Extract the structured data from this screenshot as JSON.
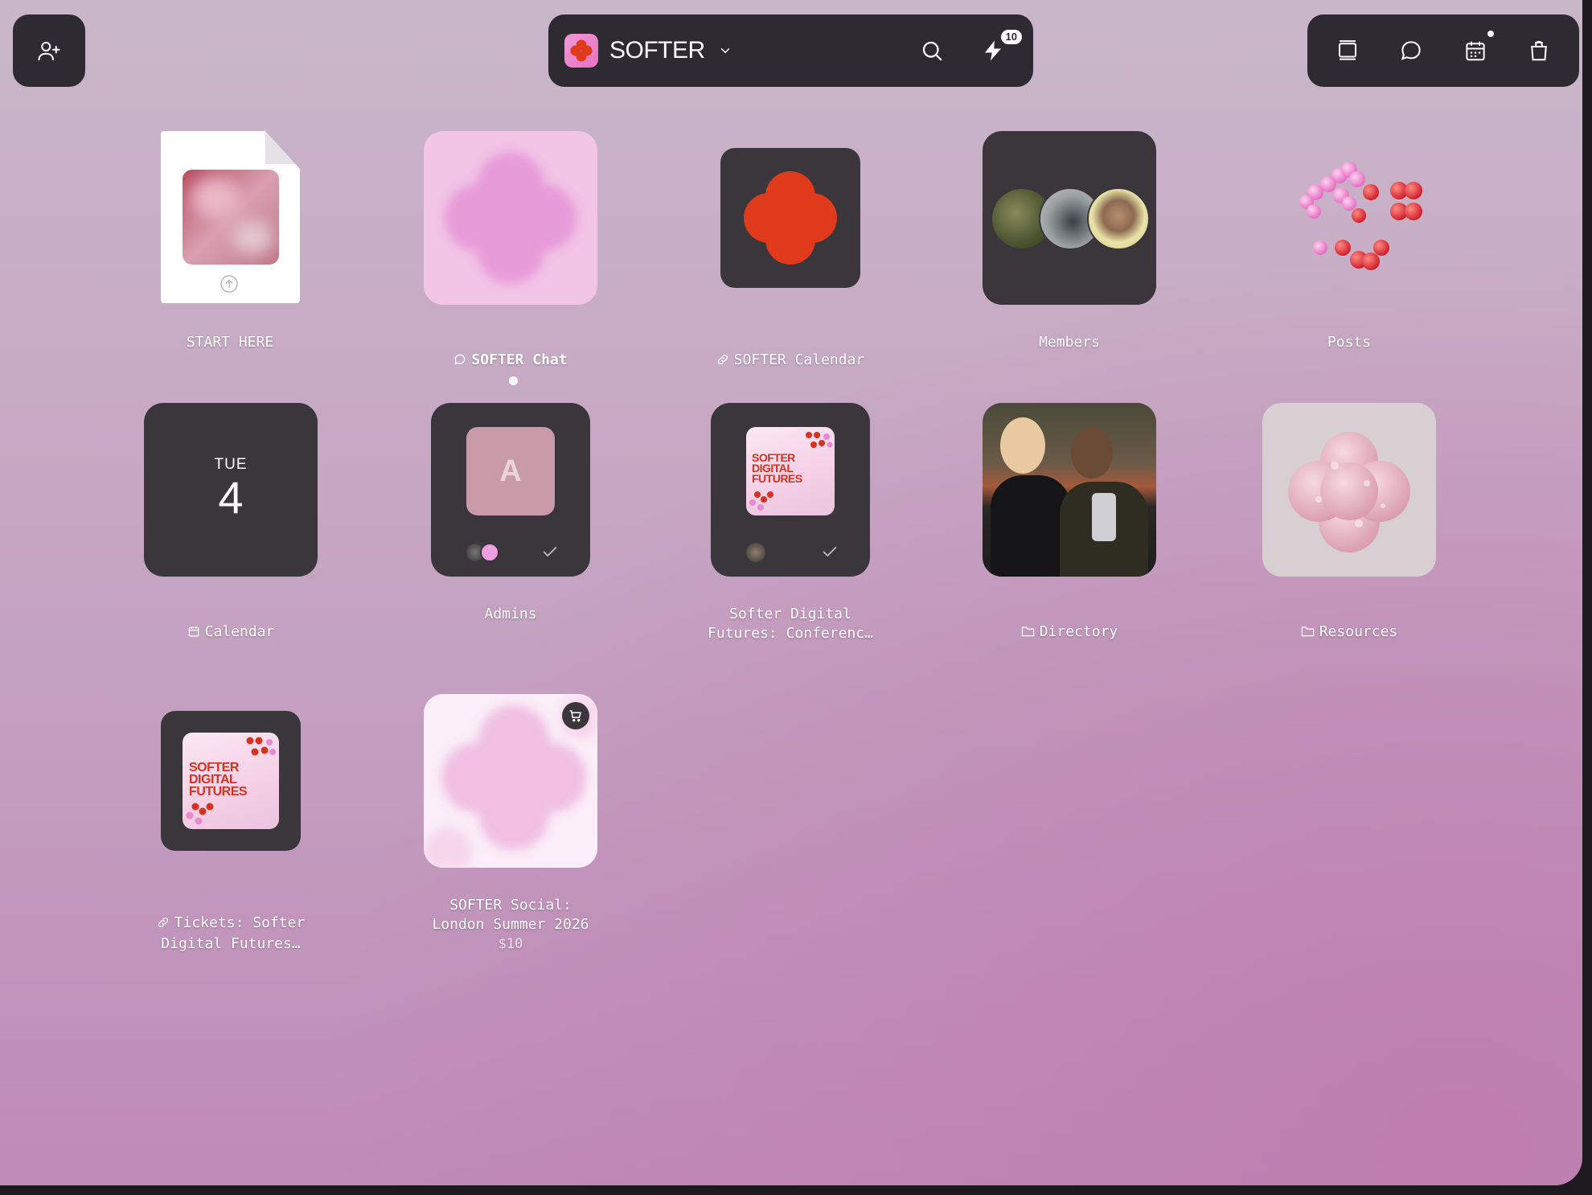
{
  "colors": {
    "bar_bg": "#2e2a31",
    "tile_dark": "#3b353c",
    "brand_pink": "#e86fc2",
    "brand_red": "#e03a1c",
    "bg_top": "#c9b6c8",
    "bg_bottom": "#bf8ab8"
  },
  "header": {
    "add_user_icon": "user-plus-icon",
    "brand_name": "SOFTER",
    "search_icon": "search-icon",
    "activity_icon": "lightning-icon",
    "activity_badge": "10",
    "right_icons": [
      "cards-icon",
      "chat-bubble-icon",
      "calendar-icon",
      "shopping-bag-icon"
    ]
  },
  "tiles": [
    {
      "id": "start-here",
      "label": "START HERE",
      "icon": "upload-icon"
    },
    {
      "id": "softer-chat",
      "label": "SOFTER Chat",
      "label_icon": "chat-bubble-icon",
      "unread": true
    },
    {
      "id": "softer-calendar",
      "label": "SOFTER Calendar",
      "label_icon": "link-icon"
    },
    {
      "id": "members",
      "label": "Members"
    },
    {
      "id": "posts",
      "label": "Posts"
    },
    {
      "id": "calendar",
      "label": "Calendar",
      "label_icon": "calendar-icon",
      "weekday": "TUE",
      "day": "4"
    },
    {
      "id": "admins",
      "label": "Admins",
      "avatar_letter": "A"
    },
    {
      "id": "softer-digital-futures",
      "label": "Softer Digital\nFutures: Conferenc…",
      "poster_text": "SOFTER\nDIGITAL\nFUTURES"
    },
    {
      "id": "directory",
      "label": "Directory",
      "label_icon": "folder-icon"
    },
    {
      "id": "resources",
      "label": "Resources",
      "label_icon": "folder-icon"
    },
    {
      "id": "tickets",
      "label": "Tickets: Softer\nDigital Futures…",
      "label_icon": "link-icon",
      "poster_text": "SOFTER\nDIGITAL\nFUTURES"
    },
    {
      "id": "softer-social",
      "label": "SOFTER Social:\nLondon Summer 2026",
      "price": "$10",
      "icon": "cart-icon"
    }
  ]
}
